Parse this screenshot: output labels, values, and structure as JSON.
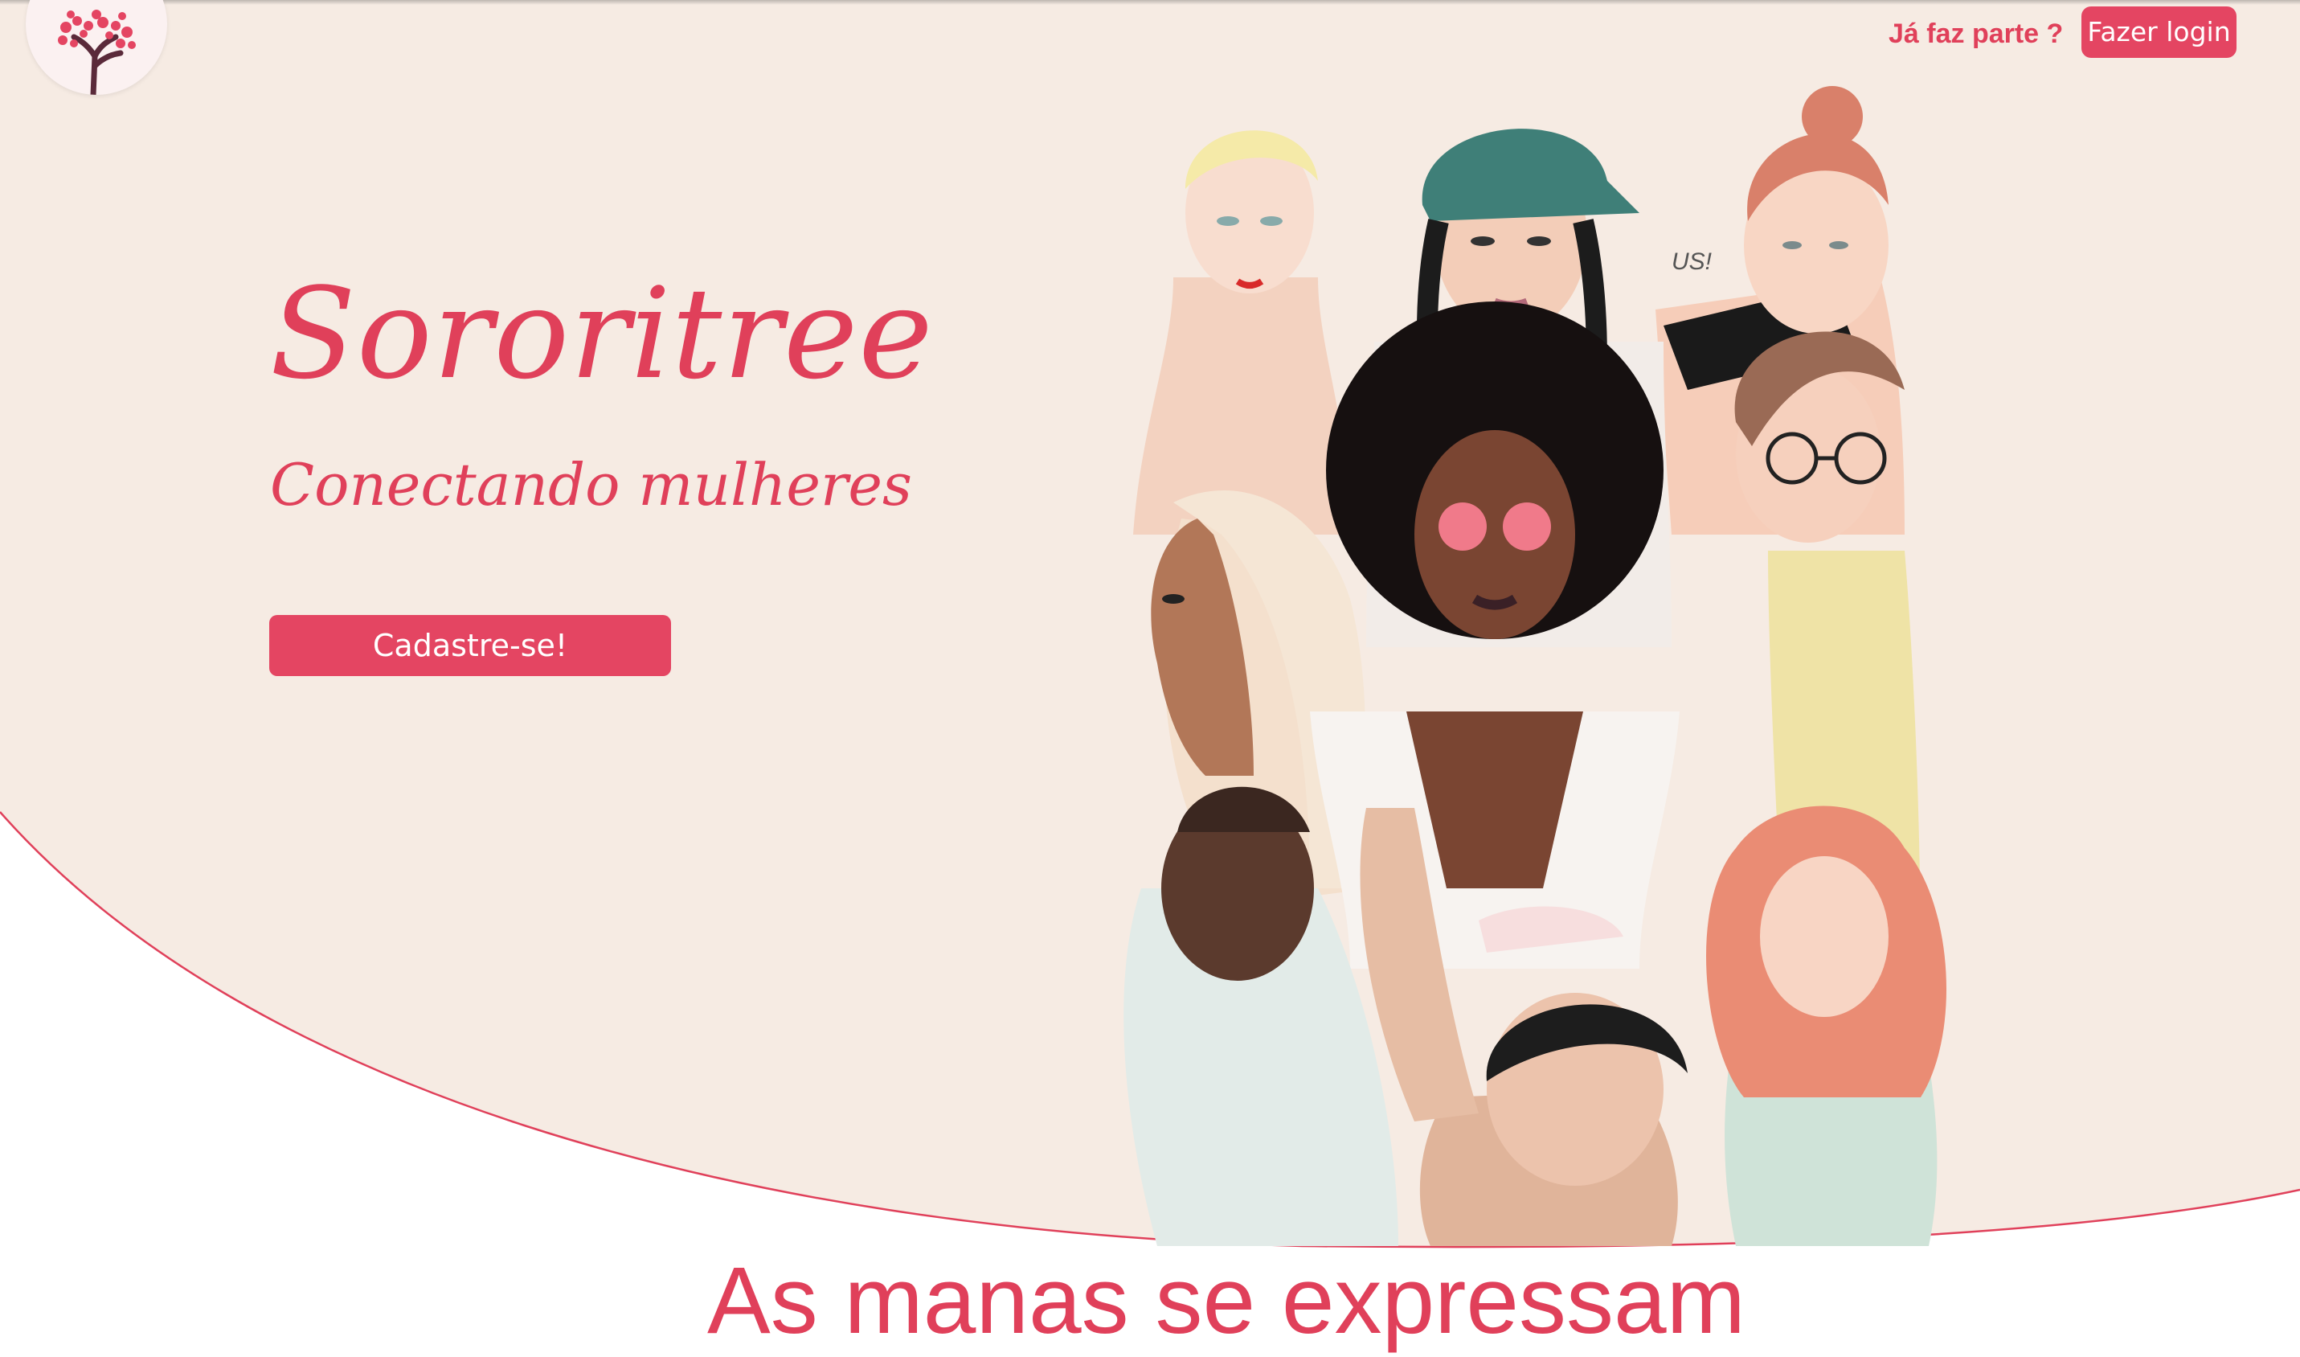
{
  "header": {
    "member_prompt": "Já faz parte ?",
    "login_label": "Fazer login"
  },
  "hero": {
    "title": "Sororitree",
    "subtitle": "Conectando mulheres",
    "signup_label": "Cadastre-se!",
    "illustration_caption": "US!"
  },
  "next_section": {
    "heading": "As manas se expressam"
  },
  "colors": {
    "accent": "#e44562",
    "hero_background": "#f6ebe3",
    "page_background": "#ffffff"
  },
  "icons": [
    "tree-logo-icon"
  ]
}
